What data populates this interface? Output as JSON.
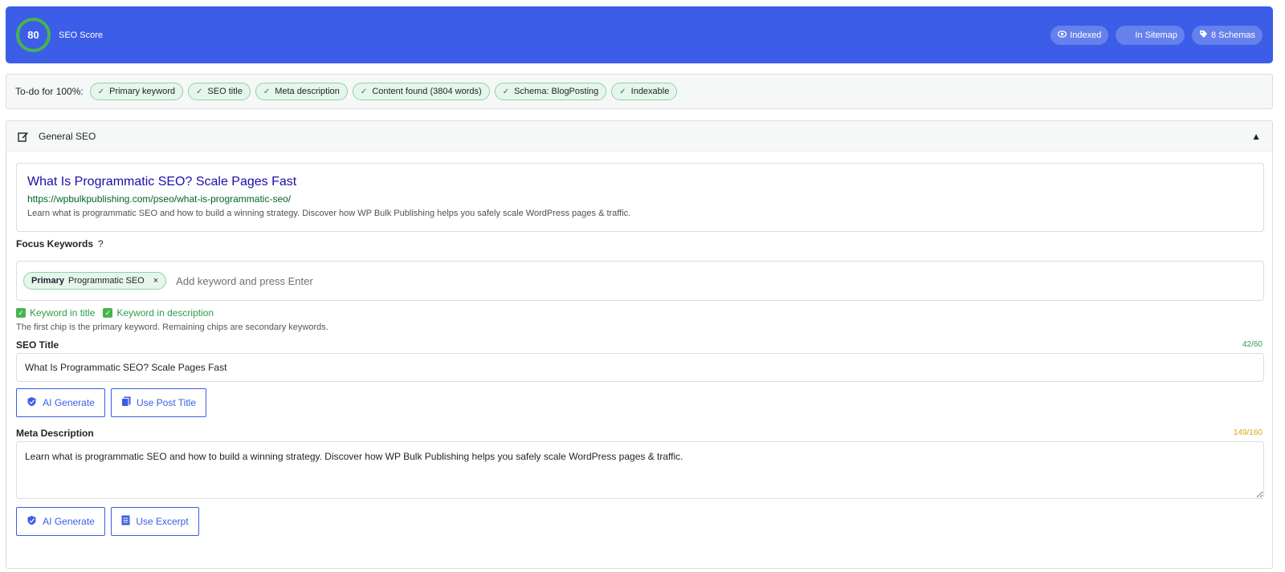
{
  "header": {
    "score": "80",
    "score_label": "SEO Score",
    "score_color": "#46b450",
    "background": "#3b5de7",
    "pills": [
      {
        "icon": "eye-icon",
        "label": "Indexed"
      },
      {
        "icon": "sitemap-icon",
        "label": "In Sitemap"
      },
      {
        "icon": "tag-icon",
        "label": "8 Schemas"
      }
    ]
  },
  "todo": {
    "label": "To-do for 100%:",
    "items": [
      "Primary keyword",
      "SEO title",
      "Meta description",
      "Content found (3804 words)",
      "Schema: BlogPosting",
      "Indexable"
    ]
  },
  "panel": {
    "title": "General SEO",
    "collapse_icon": "▲"
  },
  "preview": {
    "title": "What Is Programmatic SEO? Scale Pages Fast",
    "url": "https://wpbulkpublishing.com/pseo/what-is-programmatic-seo/",
    "description": "Learn what is programmatic SEO and how to build a winning strategy. Discover how WP Bulk Publishing helps you safely scale WordPress pages & traffic."
  },
  "keywords": {
    "label": "Focus Keywords",
    "help": "?",
    "chip_tag": "Primary",
    "chip_value": "Programmatic SEO",
    "chip_remove": "×",
    "placeholder": "Add keyword and press Enter",
    "checks": [
      "Keyword in title",
      "Keyword in description"
    ],
    "hint": "The first chip is the primary keyword. Remaining chips are secondary keywords."
  },
  "seo_title": {
    "label": "SEO Title",
    "counter": "42/60",
    "counter_color": "#2e9d49",
    "value": "What Is Programmatic SEO? Scale Pages Fast",
    "buttons": [
      "AI Generate",
      "Use Post Title"
    ]
  },
  "meta_description": {
    "label": "Meta Description",
    "counter": "149/160",
    "counter_color": "#dba617",
    "value": "Learn what is programmatic SEO and how to build a winning strategy. Discover how WP Bulk Publishing helps you safely scale WordPress pages & traffic.",
    "buttons": [
      "AI Generate",
      "Use Excerpt"
    ]
  }
}
